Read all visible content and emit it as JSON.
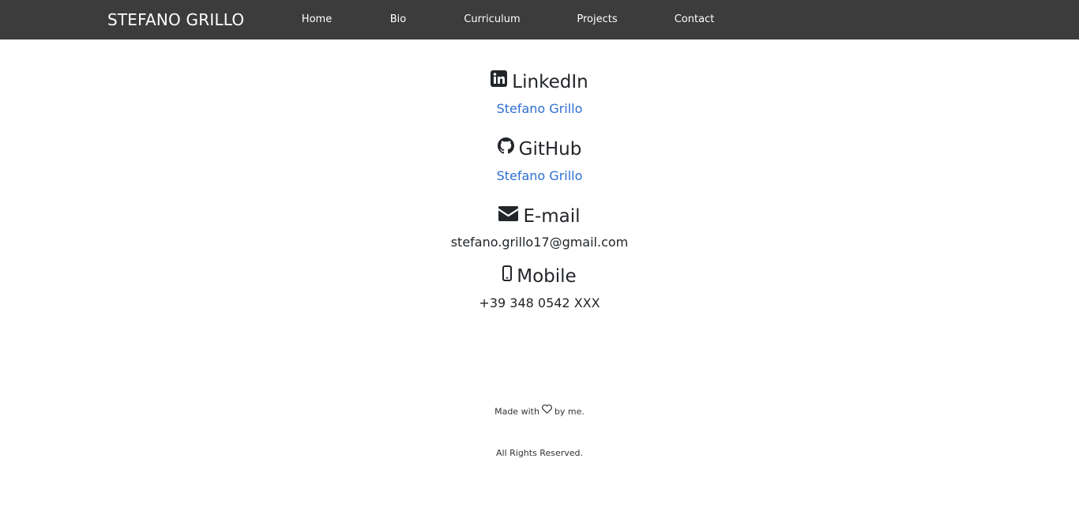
{
  "nav": {
    "brand": "STEFANO GRILLO",
    "links": [
      {
        "label": "Home"
      },
      {
        "label": "Bio"
      },
      {
        "label": "Curriculum"
      },
      {
        "label": "Projects"
      },
      {
        "label": "Contact"
      }
    ]
  },
  "contacts": {
    "linkedin": {
      "title": "LinkedIn",
      "value": "Stefano Grillo",
      "icon": "linkedin-icon"
    },
    "github": {
      "title": "GitHub",
      "value": "Stefano Grillo",
      "icon": "github-icon"
    },
    "email": {
      "title": "E-mail",
      "value": "stefano.grillo17@gmail.com",
      "icon": "envelope-icon"
    },
    "mobile": {
      "title": "Mobile",
      "value": "+39 348 0542 XXX",
      "icon": "mobile-icon"
    }
  },
  "footer": {
    "made_before": "Made with",
    "made_after": "by me.",
    "rights": "All Rights Reserved."
  },
  "colors": {
    "navbar": "#3c3c3c",
    "link": "#2f6fd1",
    "text": "#212529"
  }
}
